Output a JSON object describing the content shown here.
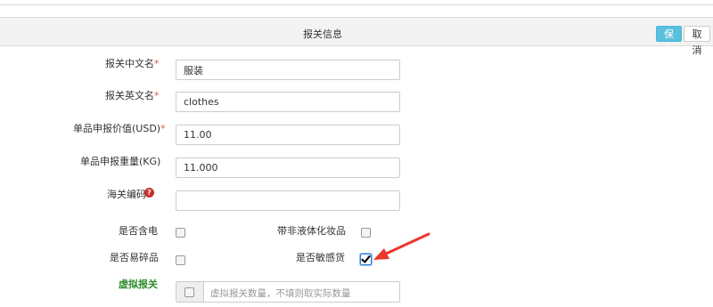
{
  "section": {
    "title": "报关信息"
  },
  "toolbar": {
    "save_label": "保存",
    "cancel_label": "取消"
  },
  "fields": {
    "cn_name": {
      "label": "报关中文名",
      "required_mark": "*",
      "value": "服装"
    },
    "en_name": {
      "label": "报关英文名",
      "required_mark": "*",
      "value": "clothes"
    },
    "declared_value": {
      "label": "单品申报价值(USD)",
      "required_mark": "*",
      "value": "11.00"
    },
    "declared_weight": {
      "label": "单品申报重量(KG)",
      "value": "11.000"
    },
    "hs_code": {
      "label": "海关编码",
      "value": "",
      "help_icon": "question-icon"
    }
  },
  "checkboxes": {
    "has_battery": {
      "label": "是否含电",
      "checked": false
    },
    "non_liquid_cosmetics": {
      "label": "带非液体化妆品",
      "checked": false
    },
    "fragile": {
      "label": "是否易碎品",
      "checked": false
    },
    "sensitive": {
      "label": "是否敏感货",
      "checked": true
    }
  },
  "virtual": {
    "label": "虚拟报关",
    "placeholder": "虚拟报关数量，不填则取实际数量",
    "label_color": "#2e8b2e"
  },
  "colors": {
    "accent": "#5bc0de",
    "required": "#d9534f",
    "annotation_arrow": "#e8372c"
  }
}
